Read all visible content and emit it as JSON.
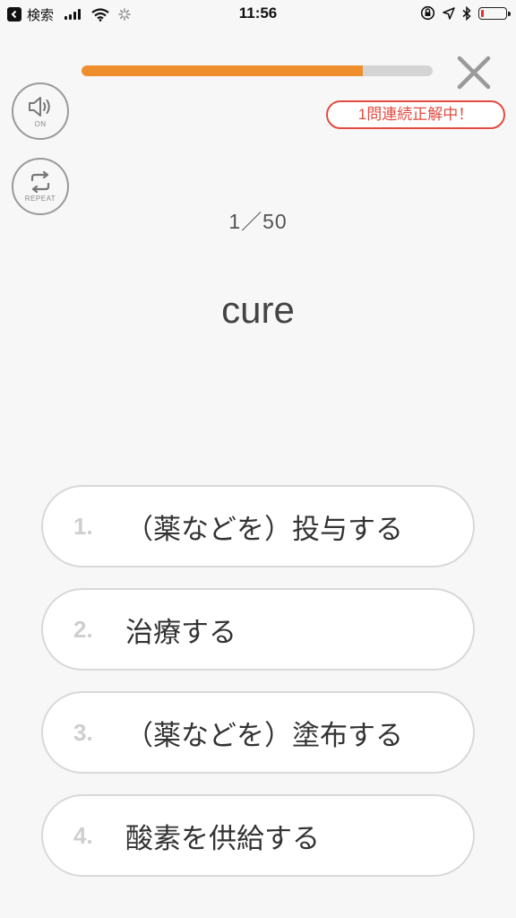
{
  "status_bar": {
    "back_label": "検索",
    "time": "11:56",
    "battery_level": 0.1,
    "icons": [
      "signal-icon",
      "wifi-icon",
      "loading-icon",
      "orientation-lock-icon",
      "location-icon",
      "bluetooth-icon",
      "battery-icon"
    ]
  },
  "quiz": {
    "progress": 0.8,
    "streak_text": "1問連続正解中！",
    "counter": "1／50",
    "word": "cure",
    "sound_caption": "ON",
    "repeat_caption": "REPEAT",
    "choices": [
      {
        "num": "1.",
        "text": "（薬などを）投与する"
      },
      {
        "num": "2.",
        "text": "治療する"
      },
      {
        "num": "3.",
        "text": "（薬などを）塗布する"
      },
      {
        "num": "4.",
        "text": "酸素を供給する"
      }
    ]
  },
  "colors": {
    "progress_fill": "#ef8e2c",
    "progress_track": "#d4d4d4",
    "streak_accent": "#e24b40",
    "background": "#f7f7f7"
  }
}
